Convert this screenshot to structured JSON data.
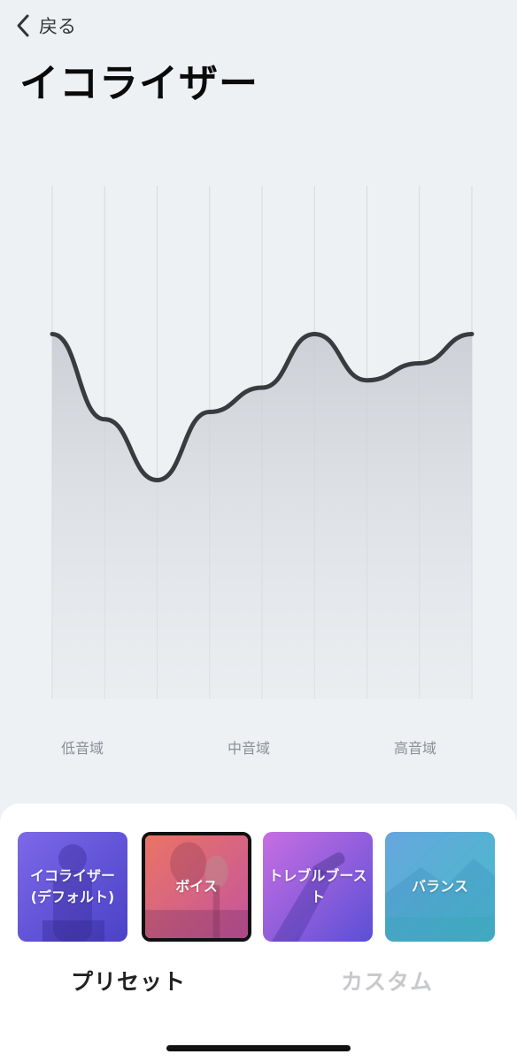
{
  "nav": {
    "back_label": "戻る"
  },
  "page": {
    "title": "イコライザー"
  },
  "bands": {
    "low": "低音域",
    "mid": "中音域",
    "high": "高音域"
  },
  "chart_data": {
    "type": "line",
    "x": [
      1,
      2,
      3,
      4,
      5,
      6,
      7,
      8,
      9
    ],
    "values": [
      1.0,
      -2.5,
      -5.0,
      -2.2,
      -1.2,
      1.0,
      -0.9,
      -0.2,
      1.0
    ],
    "ylim": [
      -6,
      2
    ],
    "grid": true,
    "area_fill": true,
    "xlabel": "",
    "ylabel": "",
    "title": ""
  },
  "presets": [
    {
      "label": "イコライザー\n(デフォルト)",
      "selected": false,
      "gradient": [
        "#7a64e6",
        "#4b43c9"
      ]
    },
    {
      "label": "ボイス",
      "selected": true,
      "gradient": [
        "#e4706a",
        "#c6579a"
      ]
    },
    {
      "label": "トレブルブースト",
      "selected": false,
      "gradient": [
        "#c36ae2",
        "#5c4fd6"
      ]
    },
    {
      "label": "バランス",
      "selected": false,
      "gradient": [
        "#63a9dc",
        "#49b8c8"
      ]
    }
  ],
  "tabs": [
    {
      "label": "プリセット",
      "active": true
    },
    {
      "label": "カスタム",
      "active": false
    }
  ],
  "colors": {
    "background": "#edf1f4",
    "curve": "#3a3b3f",
    "gridline": "#d5d9de"
  }
}
